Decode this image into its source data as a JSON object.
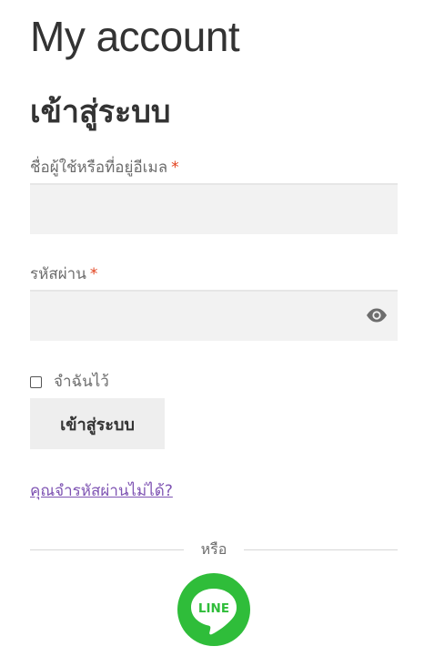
{
  "page_title": "My account",
  "login": {
    "heading": "เข้าสู่ระบบ",
    "username_label": "ชื่อผู้ใช้หรือที่อยู่อีเมล",
    "password_label": "รหัสผ่าน",
    "required_mark": "*",
    "username_value": "",
    "password_value": "",
    "remember_label": "จำฉันไว้",
    "remember_checked": false,
    "submit_label": "เข้าสู่ระบบ",
    "lost_password_link": "คุณจำรหัสผ่านไม่ได้?"
  },
  "divider": {
    "text": "หรือ"
  },
  "social": {
    "line_label": "LINE",
    "line_color": "#2fbd3a"
  },
  "icons": {
    "show_password": "eye-icon",
    "line_login": "line-logo-icon"
  },
  "colors": {
    "link": "#7f54b3",
    "required": "#e2401c",
    "input_bg": "#f2f2f2",
    "button_bg": "#eeeeee"
  }
}
